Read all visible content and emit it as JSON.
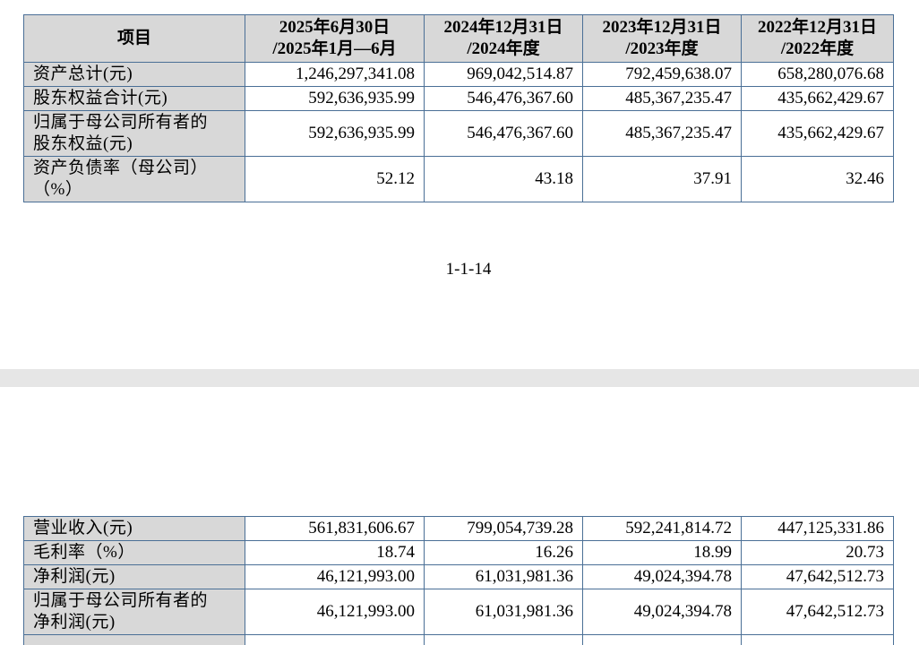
{
  "header": {
    "item": "项目",
    "col1_line1": "2025年6月30日",
    "col1_line2": "/2025年1月—6月",
    "col2_line1": "2024年12月31日",
    "col2_line2": "/2024年度",
    "col3_line1": "2023年12月31日",
    "col3_line2": "/2023年度",
    "col4_line1": "2022年12月31日",
    "col4_line2": "/2022年度"
  },
  "top_rows": [
    {
      "label_1": "资产总计(元)",
      "label_2": "",
      "values": [
        "1,246,297,341.08",
        "969,042,514.87",
        "792,459,638.07",
        "658,280,076.68"
      ]
    },
    {
      "label_1": "股东权益合计(元)",
      "label_2": "",
      "values": [
        "592,636,935.99",
        "546,476,367.60",
        "485,367,235.47",
        "435,662,429.67"
      ]
    },
    {
      "label_1": "归属于母公司所有者的",
      "label_2": "股东权益(元)",
      "values": [
        "592,636,935.99",
        "546,476,367.60",
        "485,367,235.47",
        "435,662,429.67"
      ]
    },
    {
      "label_1": "资产负债率（母公司）",
      "label_2": "（%）",
      "values": [
        "52.12",
        "43.18",
        "37.91",
        "32.46"
      ]
    }
  ],
  "page_number": "1-1-14",
  "bottom_rows": [
    {
      "label_1": "营业收入(元)",
      "label_2": "",
      "values": [
        "561,831,606.67",
        "799,054,739.28",
        "592,241,814.72",
        "447,125,331.86"
      ]
    },
    {
      "label_1": "毛利率（%）",
      "label_2": "",
      "values": [
        "18.74",
        "16.26",
        "18.99",
        "20.73"
      ]
    },
    {
      "label_1": "净利润(元)",
      "label_2": "",
      "values": [
        "46,121,993.00",
        "61,031,981.36",
        "49,024,394.78",
        "47,642,512.73"
      ]
    },
    {
      "label_1": "归属于母公司所有者的",
      "label_2": "净利润(元)",
      "values": [
        "46,121,993.00",
        "61,031,981.36",
        "49,024,394.78",
        "47,642,512.73"
      ]
    }
  ]
}
